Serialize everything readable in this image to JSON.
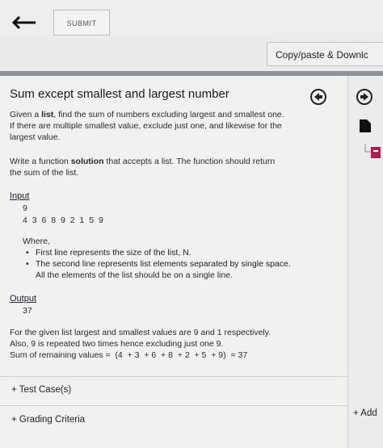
{
  "toolbar": {
    "submit_label": "SUBMIT",
    "copy_label": "Copy/paste & Downlc"
  },
  "problem": {
    "title": "Sum except smallest and largest number",
    "desc_line1_pre": "Given a ",
    "desc_line1_bold": "list",
    "desc_line1_post": ", find the sum of numbers excluding largest and smallest one.",
    "desc_line2": "If there are multiple smallest value, exclude just one, and likewise for the",
    "desc_line3": "largest value.",
    "write_pre": "Write a function ",
    "write_bold": "solution",
    "write_post": " that accepts a list. The function should return",
    "write_line2": "the sum of the list.",
    "input_label": "Input",
    "input_n": "9",
    "input_list": "4 3 6 8 9 2 1 5 9",
    "where_label": "Where,",
    "bullets": [
      "First line represents the size of the list, N.",
      "The second line represents list elements separated by single space."
    ],
    "bullet_note": "All the elements of the list should be on a single line.",
    "output_label": "Output",
    "output_value": "37",
    "explain_line1": "For the given list largest and smallest values are 9 and 1 respectively.",
    "explain_line2": "Also, 9 is repeated two times hence excluding just one 9.",
    "explain_line3": "Sum of remaining values =  (4  + 3  + 6  + 8  + 2  + 5  + 9)  = 37"
  },
  "sections": {
    "test_cases": "+ Test Case(s)",
    "grading": "+ Grading Criteria",
    "add": "+ Add"
  },
  "icons": [
    "back-arrow-icon",
    "arrow-left-circle-icon",
    "arrow-right-circle-icon",
    "file-icon",
    "side-tab-icon"
  ]
}
